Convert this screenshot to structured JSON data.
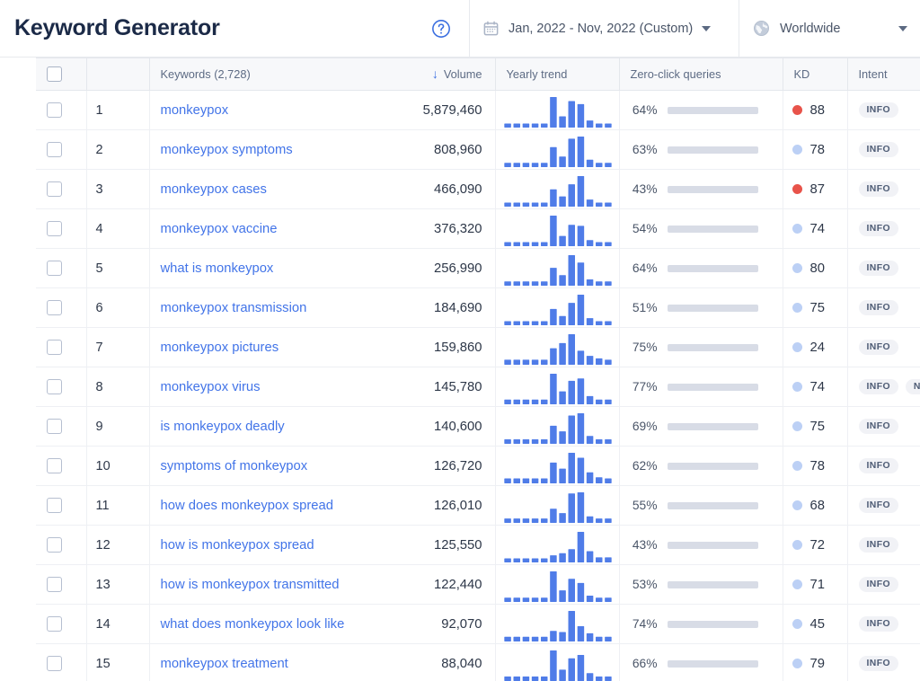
{
  "header": {
    "title": "Keyword Generator",
    "help_icon": "question-circle-icon",
    "date_range": {
      "icon": "calendar-icon",
      "label": "Jan, 2022 - Nov, 2022 (Custom)",
      "caret": "chevron-down-icon"
    },
    "location": {
      "icon": "globe-icon",
      "label": "Worldwide",
      "caret": "chevron-down-icon"
    }
  },
  "table": {
    "columns": {
      "select_all": "",
      "number": "",
      "keywords": "Keywords (2,728)",
      "volume": "Volume",
      "volume_sort": "↓",
      "yearly_trend": "Yearly trend",
      "zero_click": "Zero-click queries",
      "kd": "KD",
      "intent": "Intent"
    },
    "colors": {
      "link": "#4274e8",
      "bar": "#4f7ce8",
      "bar_track": "#d8dce6",
      "kd_high": "#e8534a",
      "kd_low": "#bcd0f5",
      "accent": "#3b6fe0"
    },
    "rows": [
      {
        "num": "1",
        "keyword": "monkeypox",
        "volume": "5,879,460",
        "trend": [
          4,
          4,
          4,
          4,
          4,
          30,
          11,
          26,
          23,
          7,
          4,
          4
        ],
        "zero_pct": "64%",
        "zero_val": 64,
        "kd": "88",
        "kd_level": "high",
        "intents": [
          "INFO"
        ]
      },
      {
        "num": "2",
        "keyword": "monkeypox symptoms",
        "volume": "808,960",
        "trend": [
          4,
          4,
          4,
          4,
          4,
          19,
          10,
          27,
          29,
          7,
          4,
          4
        ],
        "zero_pct": "63%",
        "zero_val": 63,
        "kd": "78",
        "kd_level": "low",
        "intents": [
          "INFO"
        ]
      },
      {
        "num": "3",
        "keyword": "monkeypox cases",
        "volume": "466,090",
        "trend": [
          4,
          4,
          4,
          4,
          4,
          17,
          10,
          22,
          30,
          7,
          4,
          4
        ],
        "zero_pct": "43%",
        "zero_val": 43,
        "kd": "87",
        "kd_level": "high",
        "intents": [
          "INFO"
        ]
      },
      {
        "num": "4",
        "keyword": "monkeypox vaccine",
        "volume": "376,320",
        "trend": [
          4,
          4,
          4,
          4,
          4,
          30,
          10,
          21,
          20,
          6,
          4,
          4
        ],
        "zero_pct": "54%",
        "zero_val": 54,
        "kd": "74",
        "kd_level": "low",
        "intents": [
          "INFO"
        ]
      },
      {
        "num": "5",
        "keyword": "what is monkeypox",
        "volume": "256,990",
        "trend": [
          4,
          4,
          4,
          4,
          4,
          17,
          10,
          29,
          22,
          6,
          4,
          4
        ],
        "zero_pct": "64%",
        "zero_val": 64,
        "kd": "80",
        "kd_level": "low",
        "intents": [
          "INFO"
        ]
      },
      {
        "num": "6",
        "keyword": "monkeypox transmission",
        "volume": "184,690",
        "trend": [
          4,
          4,
          4,
          4,
          4,
          16,
          9,
          22,
          30,
          7,
          4,
          4
        ],
        "zero_pct": "51%",
        "zero_val": 51,
        "kd": "75",
        "kd_level": "low",
        "intents": [
          "INFO"
        ]
      },
      {
        "num": "7",
        "keyword": "monkeypox pictures",
        "volume": "159,860",
        "trend": [
          4,
          4,
          4,
          4,
          4,
          13,
          17,
          24,
          11,
          7,
          5,
          4
        ],
        "zero_pct": "75%",
        "zero_val": 75,
        "kd": "24",
        "kd_level": "low",
        "intents": [
          "INFO"
        ]
      },
      {
        "num": "8",
        "keyword": "monkeypox virus",
        "volume": "145,780",
        "trend": [
          4,
          4,
          4,
          4,
          4,
          26,
          11,
          20,
          22,
          7,
          4,
          4
        ],
        "zero_pct": "77%",
        "zero_val": 77,
        "kd": "74",
        "kd_level": "low",
        "intents": [
          "INFO",
          "NAV"
        ]
      },
      {
        "num": "9",
        "keyword": "is monkeypox deadly",
        "volume": "140,600",
        "trend": [
          4,
          4,
          4,
          4,
          4,
          16,
          11,
          25,
          27,
          7,
          4,
          4
        ],
        "zero_pct": "69%",
        "zero_val": 69,
        "kd": "75",
        "kd_level": "low",
        "intents": [
          "INFO"
        ]
      },
      {
        "num": "10",
        "keyword": "symptoms of monkeypox",
        "volume": "126,720",
        "trend": [
          4,
          4,
          4,
          4,
          4,
          17,
          12,
          25,
          21,
          9,
          5,
          4
        ],
        "zero_pct": "62%",
        "zero_val": 62,
        "kd": "78",
        "kd_level": "low",
        "intents": [
          "INFO"
        ]
      },
      {
        "num": "11",
        "keyword": "how does monkeypox spread",
        "volume": "126,010",
        "trend": [
          4,
          4,
          4,
          4,
          4,
          13,
          9,
          27,
          28,
          6,
          4,
          4
        ],
        "zero_pct": "55%",
        "zero_val": 55,
        "kd": "68",
        "kd_level": "low",
        "intents": [
          "INFO"
        ]
      },
      {
        "num": "12",
        "keyword": "how is monkeypox spread",
        "volume": "125,550",
        "trend": [
          4,
          4,
          4,
          4,
          4,
          7,
          9,
          13,
          30,
          11,
          5,
          5
        ],
        "zero_pct": "43%",
        "zero_val": 43,
        "kd": "72",
        "kd_level": "low",
        "intents": [
          "INFO"
        ]
      },
      {
        "num": "13",
        "keyword": "how is monkeypox transmitted",
        "volume": "122,440",
        "trend": [
          4,
          4,
          4,
          4,
          4,
          29,
          11,
          22,
          18,
          6,
          4,
          4
        ],
        "zero_pct": "53%",
        "zero_val": 53,
        "kd": "71",
        "kd_level": "low",
        "intents": [
          "INFO"
        ]
      },
      {
        "num": "14",
        "keyword": "what does monkeypox look like",
        "volume": "92,070",
        "trend": [
          4,
          4,
          4,
          4,
          4,
          9,
          8,
          26,
          13,
          7,
          4,
          4
        ],
        "zero_pct": "74%",
        "zero_val": 74,
        "kd": "45",
        "kd_level": "low",
        "intents": [
          "INFO"
        ]
      },
      {
        "num": "15",
        "keyword": "monkeypox treatment",
        "volume": "88,040",
        "trend": [
          4,
          4,
          4,
          4,
          4,
          27,
          10,
          20,
          23,
          7,
          4,
          4
        ],
        "zero_pct": "66%",
        "zero_val": 66,
        "kd": "79",
        "kd_level": "low",
        "intents": [
          "INFO"
        ]
      }
    ]
  }
}
